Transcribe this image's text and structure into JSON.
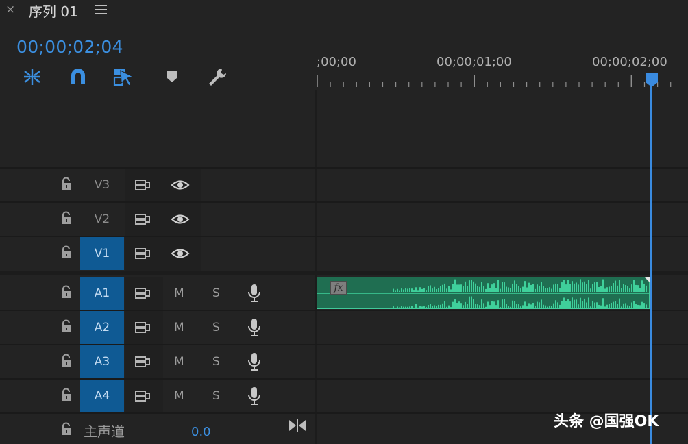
{
  "panel": {
    "close_label": "×",
    "title": "序列 01",
    "menu_icon": "hamburger-icon"
  },
  "timecode": "00;00;02;04",
  "toolbar": {
    "icons": [
      "ripple-insert-icon",
      "snap-icon",
      "linked-selection-icon",
      "add-marker-icon",
      "settings-wrench-icon"
    ]
  },
  "ruler": {
    "labels": [
      ";00;00",
      "00;00;01;00",
      "00;00;02;00"
    ]
  },
  "tracks": {
    "video": [
      {
        "name": "V3",
        "targeted": false
      },
      {
        "name": "V2",
        "targeted": false
      },
      {
        "name": "V1",
        "targeted": true
      }
    ],
    "audio": [
      {
        "name": "A1",
        "targeted": true,
        "mute": "M",
        "solo": "S"
      },
      {
        "name": "A2",
        "targeted": true,
        "mute": "M",
        "solo": "S"
      },
      {
        "name": "A3",
        "targeted": true,
        "mute": "M",
        "solo": "S"
      },
      {
        "name": "A4",
        "targeted": true,
        "mute": "M",
        "solo": "S"
      }
    ]
  },
  "clip": {
    "fx_label": "fx",
    "color": "#1f6e51"
  },
  "master": {
    "label": "主声道",
    "value": "0.0"
  },
  "watermark": "头条 @国强OK",
  "colors": {
    "accent": "#3b8fe0",
    "target_track": "#0f5a94",
    "audio_clip": "#34c08a"
  }
}
